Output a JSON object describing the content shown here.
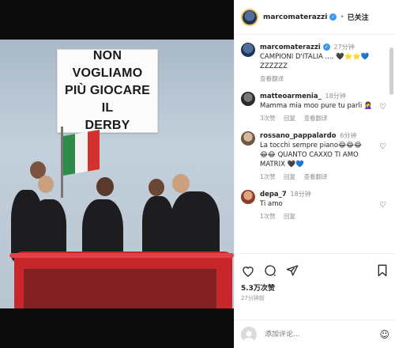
{
  "post": {
    "sign_text": "NON VOGLIAMO\nPIÙ GIOCARE IL\nDERBY",
    "flag_colors": [
      "#2f8a4a",
      "#f4f4f4",
      "#d3312e"
    ]
  },
  "header": {
    "username": "marcomaterazzi",
    "verified_icon": "verified-badge-icon",
    "separator": "•",
    "follow_status": "已关注",
    "story_ring_color": "#f1c35b"
  },
  "comments": [
    {
      "username": "marcomaterazzi",
      "verified": true,
      "time": "27分钟",
      "text": "CAMPIONI D'ITALIA .... 🖤⭐⭐💙\nZZZZZZ",
      "meta": [
        "查看翻译"
      ],
      "avatar_color": "#1f3556"
    },
    {
      "username": "matteoarmenia_",
      "time": "18分钟",
      "text": "Mamma mia moo pure tu parli 🤦‍♀️",
      "meta": [
        "3次赞",
        "回复",
        "查看翻译"
      ],
      "avatar_color": "#333333"
    },
    {
      "username": "rossano_pappalardo",
      "time": "6分钟",
      "text": "La tocchi sempre piano😂😂😂\n😂😂 QUANTO CAXXO TI AMO\nMATRIX 🖤💙",
      "meta": [
        "1次赞",
        "回复",
        "查看翻译"
      ],
      "avatar_color": "#9c8470"
    },
    {
      "username": "depa_7",
      "time": "18分钟",
      "text": "Ti amo",
      "meta": [
        "1次赞",
        "回复"
      ],
      "avatar_color": "#c06a4a"
    }
  ],
  "actions": {
    "like_icon": "heart-icon",
    "comment_icon": "comment-icon",
    "share_icon": "share-icon",
    "save_icon": "bookmark-icon"
  },
  "stats": {
    "likes": "5.3万次赞",
    "posted": "27分钟前"
  },
  "add_comment": {
    "placeholder": "添加评论...",
    "emoji_icon": "smiley-icon"
  }
}
